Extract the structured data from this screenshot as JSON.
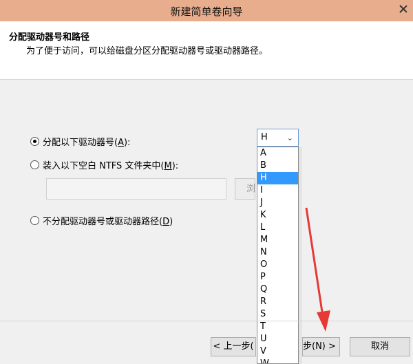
{
  "window": {
    "title": "新建简单卷向导"
  },
  "header": {
    "title": "分配驱动器号和路径",
    "subtitle": "为了便于访问，可以给磁盘分区分配驱动器号或驱动器路径。"
  },
  "options": {
    "assign_letter": {
      "prefix": "分配以下驱动器号(",
      "key": "A",
      "suffix": "):"
    },
    "mount_folder": {
      "prefix": "装入以下空白 NTFS 文件夹中(",
      "key": "M",
      "suffix": "):"
    },
    "no_assign": {
      "prefix": "不分配驱动器号或驱动器路径(",
      "key": "D",
      "suffix": ")"
    }
  },
  "drive_select": {
    "selected": "H"
  },
  "drive_letters": [
    "A",
    "B",
    "H",
    "I",
    "J",
    "K",
    "L",
    "M",
    "N",
    "O",
    "P",
    "Q",
    "R",
    "S",
    "T",
    "U",
    "V",
    "W"
  ],
  "browse": {
    "label": "浏"
  },
  "buttons": {
    "back": "< 上一步(",
    "next": "步(N) >",
    "cancel": "取消"
  },
  "colors": {
    "titlebar": "#e8ad8d",
    "selection": "#3399ff",
    "annotation_arrow": "#e53935"
  }
}
